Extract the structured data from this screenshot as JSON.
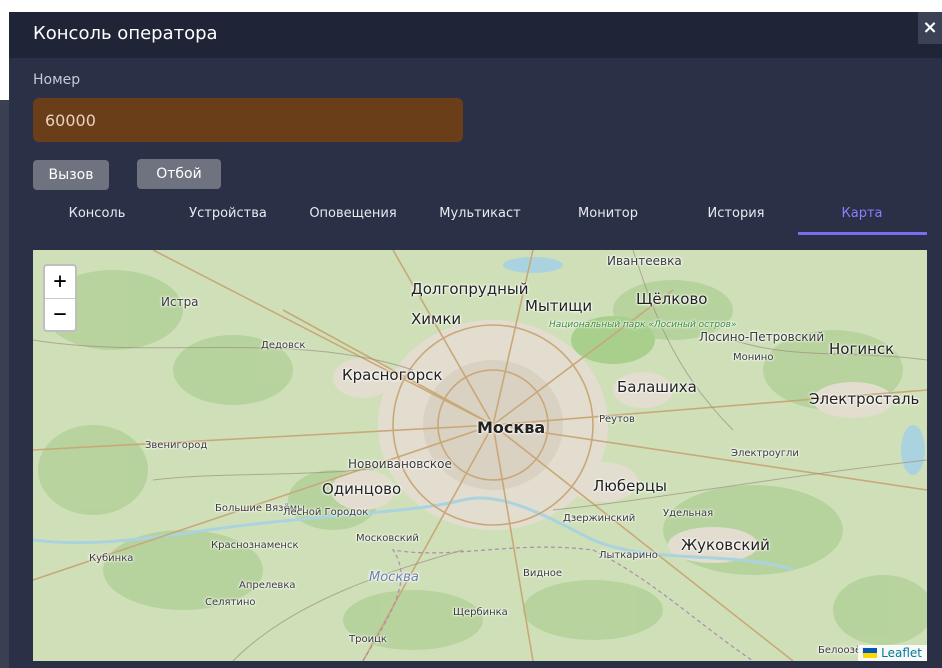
{
  "modal": {
    "title": "Консоль оператора",
    "close_symbol": "×"
  },
  "form": {
    "number_label": "Номер",
    "number_value": "60000"
  },
  "buttons": {
    "call": "Вызов",
    "hangup": "Отбой"
  },
  "tabs": [
    {
      "label": "Консоль",
      "active": false
    },
    {
      "label": "Устройства",
      "active": false
    },
    {
      "label": "Оповещения",
      "active": false
    },
    {
      "label": "Мультикаст",
      "active": false
    },
    {
      "label": "Монитор",
      "active": false
    },
    {
      "label": "История",
      "active": false
    },
    {
      "label": "Карта",
      "active": true
    }
  ],
  "map": {
    "zoom_in": "+",
    "zoom_out": "−",
    "attribution": "Leaflet",
    "labels": {
      "moskva": "Москва",
      "dolgoprudny": "Долгопрудный",
      "mytishchi": "Мытищи",
      "shchelkovo": "Щёлково",
      "ivanteevka": "Ивантеевка",
      "khimki": "Химки",
      "istra": "Истра",
      "dedovsk": "Дедовск",
      "krasnogorsk": "Красногорск",
      "park": "Национальный парк «Лосиный остров»",
      "losino": "Лосино-Петровский",
      "monino": "Монино",
      "noginsk": "Ногинск",
      "balashikha": "Балашиха",
      "elektrostal": "Электросталь",
      "reutov": "Реутов",
      "zvenigorod": "Звенигород",
      "novoivankovskoe": "Новоивановское",
      "elektrougli": "Электроугли",
      "odintsovo": "Одинцово",
      "lyubertsy": "Люберцы",
      "bolshie": "Большие Вязёмы",
      "lesnoy": "Лесной Городок",
      "dzerzhinsky": "Дзержинский",
      "udelnaya": "Удельная",
      "krasnoznamensk": "Краснознаменск",
      "moskovsky": "Московский",
      "zhukovsky": "Жуковский",
      "kubinka": "Кубинка",
      "lytkarino": "Лыткарино",
      "vidnoe": "Видное",
      "moskva_region": "Москва",
      "aprelevka": "Апрелевка",
      "selyatino": "Селятино",
      "shcherbinka": "Щербинка",
      "troitsk": "Троицк",
      "beloozersky": "Белоозёр"
    }
  },
  "colors": {
    "modal_bg": "#2a3045",
    "header_bg": "#1f2536",
    "input_bg": "#6b3e1a",
    "button_bg": "#6f7380",
    "tab_active": "#8f7cff",
    "map_green": "#cfe0b9"
  }
}
